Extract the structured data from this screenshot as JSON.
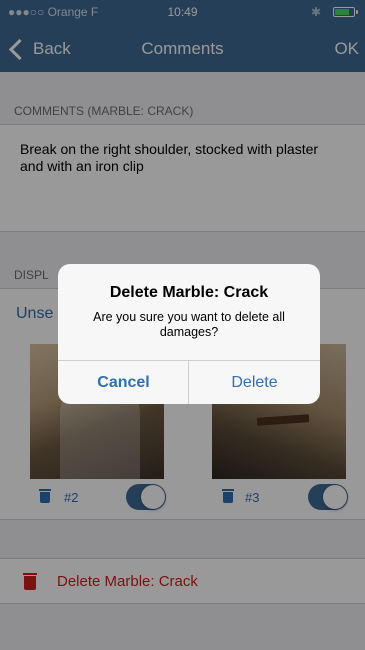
{
  "status_bar": {
    "carrier": "●●●○○ Orange F",
    "time": "10:49",
    "bluetooth": "✱"
  },
  "nav": {
    "back_label": "Back",
    "title": "Comments",
    "ok_label": "OK"
  },
  "comments_section": {
    "header": "COMMENTS (MARBLE: CRACK)",
    "text": "Break on the right shoulder, stocked with plaster and with an iron clip"
  },
  "display_section": {
    "header": "DISPL",
    "unselect_label": "Unse"
  },
  "items": [
    {
      "number": "#2",
      "enabled": true
    },
    {
      "number": "#3",
      "enabled": true
    }
  ],
  "delete_row": {
    "label": "Delete Marble: Crack"
  },
  "alert": {
    "title": "Delete Marble: Crack",
    "message": "Are you sure you want to delete all damages?",
    "cancel_label": "Cancel",
    "delete_label": "Delete"
  },
  "colors": {
    "nav_bg": "#3f6a95",
    "accent": "#2f6fb3",
    "destructive": "#cc1f1f"
  }
}
